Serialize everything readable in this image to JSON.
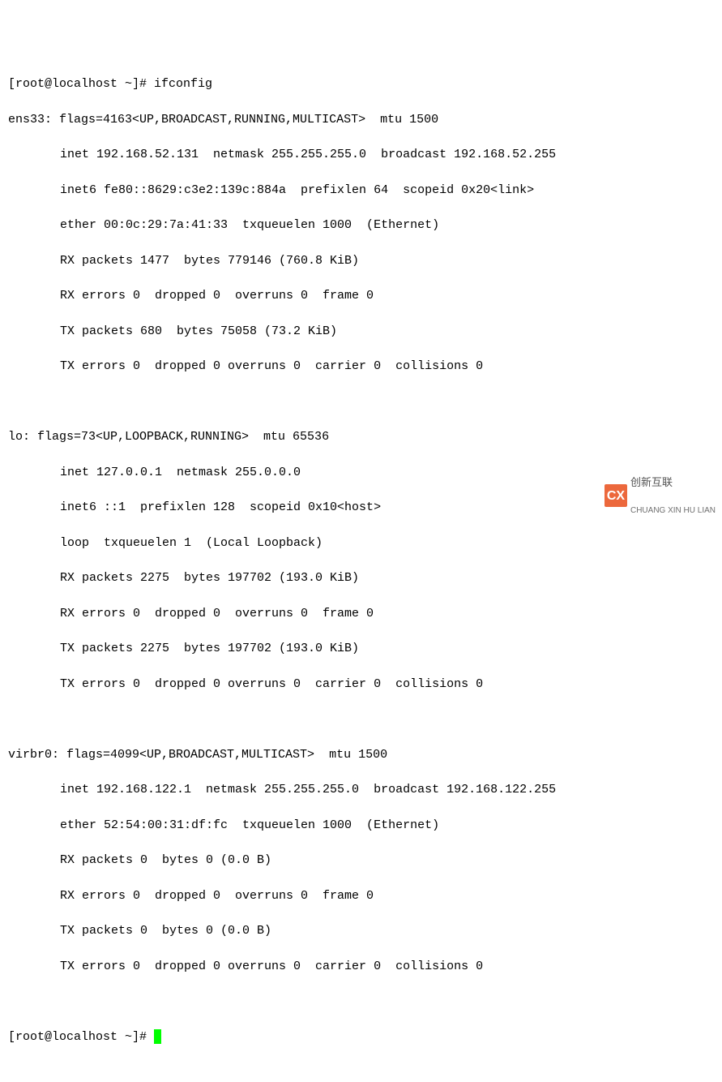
{
  "prompt1": "[root@localhost ~]# ",
  "command": "ifconfig",
  "iface1": {
    "header": "ens33: flags=4163<UP,BROADCAST,RUNNING,MULTICAST>  mtu 1500",
    "l1": "inet 192.168.52.131  netmask 255.255.255.0  broadcast 192.168.52.255",
    "l2": "inet6 fe80::8629:c3e2:139c:884a  prefixlen 64  scopeid 0x20<link>",
    "l3": "ether 00:0c:29:7a:41:33  txqueuelen 1000  (Ethernet)",
    "l4": "RX packets 1477  bytes 779146 (760.8 KiB)",
    "l5": "RX errors 0  dropped 0  overruns 0  frame 0",
    "l6": "TX packets 680  bytes 75058 (73.2 KiB)",
    "l7": "TX errors 0  dropped 0 overruns 0  carrier 0  collisions 0"
  },
  "iface2": {
    "header": "lo: flags=73<UP,LOOPBACK,RUNNING>  mtu 65536",
    "l1": "inet 127.0.0.1  netmask 255.0.0.0",
    "l2": "inet6 ::1  prefixlen 128  scopeid 0x10<host>",
    "l3": "loop  txqueuelen 1  (Local Loopback)",
    "l4": "RX packets 2275  bytes 197702 (193.0 KiB)",
    "l5": "RX errors 0  dropped 0  overruns 0  frame 0",
    "l6": "TX packets 2275  bytes 197702 (193.0 KiB)",
    "l7": "TX errors 0  dropped 0 overruns 0  carrier 0  collisions 0"
  },
  "iface3": {
    "header": "virbr0: flags=4099<UP,BROADCAST,MULTICAST>  mtu 1500",
    "l1": "inet 192.168.122.1  netmask 255.255.255.0  broadcast 192.168.122.255",
    "l2": "ether 52:54:00:31:df:fc  txqueuelen 1000  (Ethernet)",
    "l3": "RX packets 0  bytes 0 (0.0 B)",
    "l4": "RX errors 0  dropped 0  overruns 0  frame 0",
    "l5": "TX packets 0  bytes 0 (0.0 B)",
    "l6": "TX errors 0  dropped 0 overruns 0  carrier 0  collisions 0"
  },
  "prompt2": "[root@localhost ~]# ",
  "watermark": {
    "logo": "CX",
    "cn": "创新互联",
    "en": "CHUANG XIN HU LIAN"
  }
}
